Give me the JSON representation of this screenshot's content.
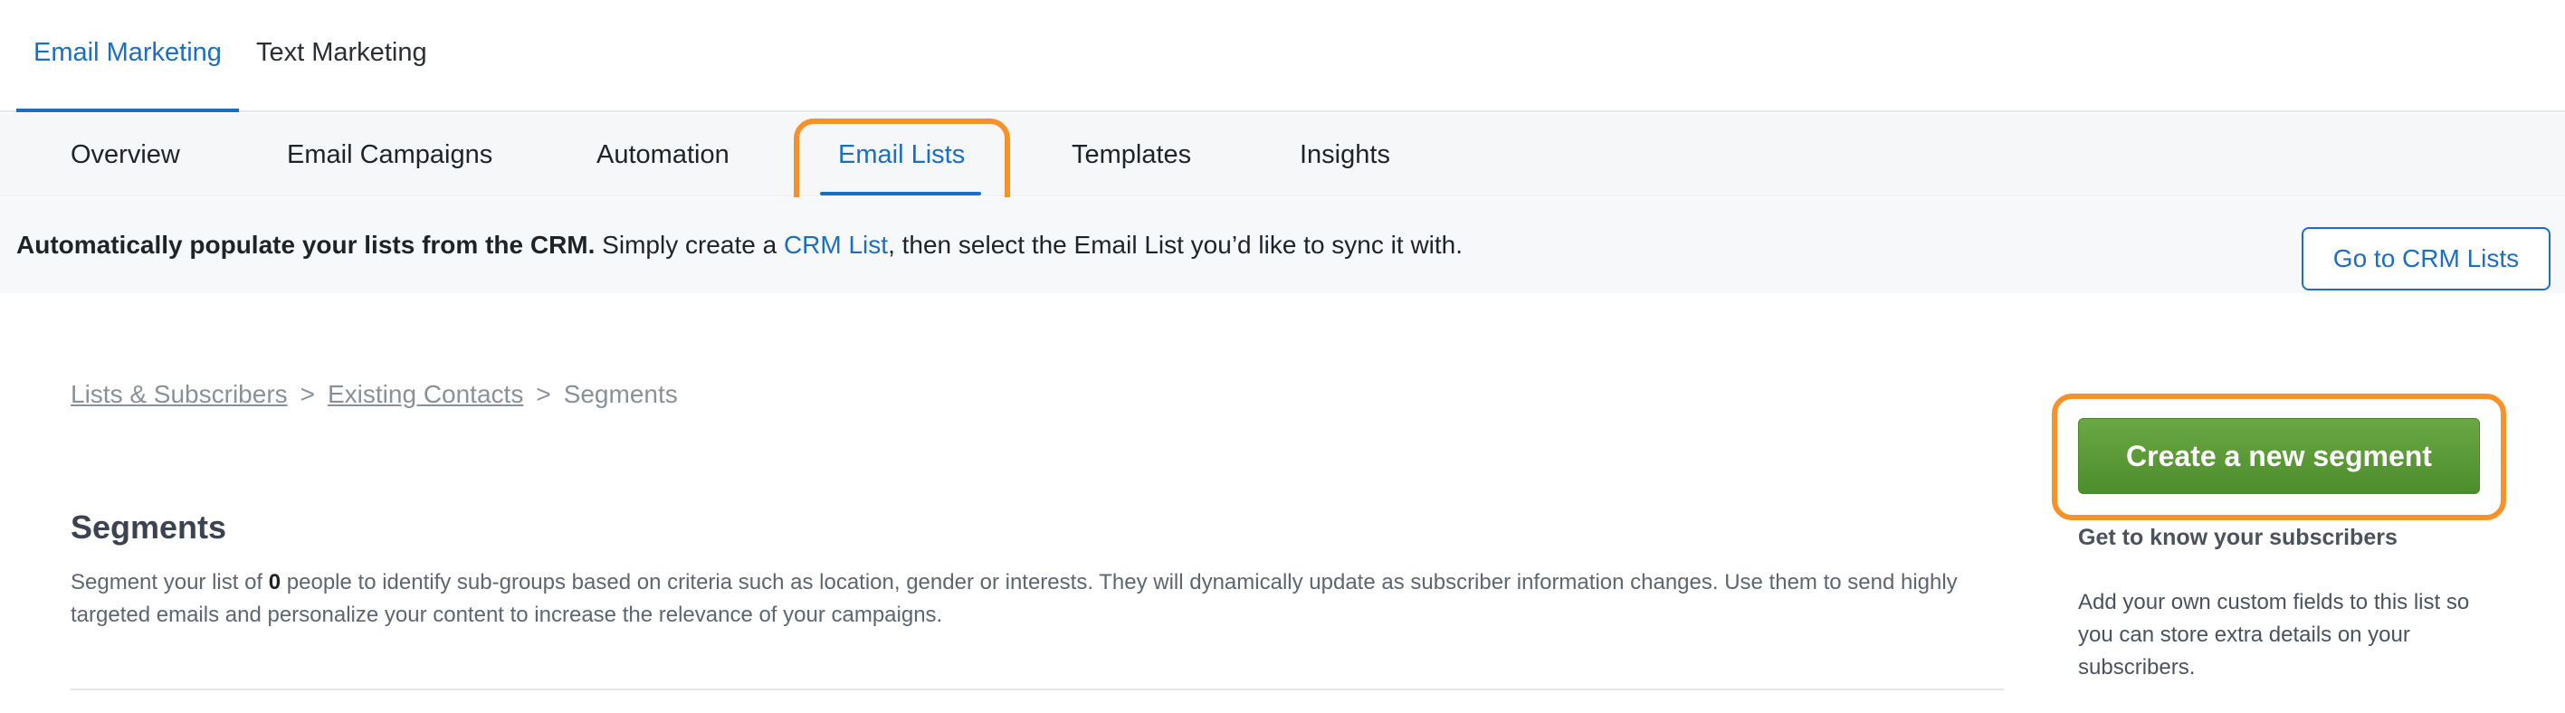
{
  "top_tabs": [
    {
      "label": "Email Marketing",
      "active": true
    },
    {
      "label": "Text Marketing",
      "active": false
    }
  ],
  "sub_nav": [
    {
      "label": "Overview"
    },
    {
      "label": "Email Campaigns"
    },
    {
      "label": "Automation"
    },
    {
      "label": "Email Lists",
      "active": true
    },
    {
      "label": "Templates"
    },
    {
      "label": "Insights"
    }
  ],
  "banner": {
    "bold": "Automatically populate your lists from the CRM.",
    "pre_link": " Simply create a ",
    "link": "CRM List",
    "post_link": ", then select the Email List you’d like to sync it with.",
    "button": "Go to CRM Lists"
  },
  "breadcrumb": {
    "items": [
      "Lists & Subscribers",
      "Existing Contacts",
      "Segments"
    ],
    "separator": ">"
  },
  "main": {
    "title": "Segments",
    "desc_pre": "Segment your list of ",
    "desc_count": "0",
    "desc_post": " people to identify sub-groups based on criteria such as location, gender or interests. They will dynamically update as subscriber information changes. Use them to send highly targeted emails and personalize your content to increase the relevance of your campaigns."
  },
  "sidebar": {
    "create_button": "Create a new segment",
    "heading": "Get to know your subscribers",
    "text": "Add your own custom fields to this list so you can store extra details on your subscribers."
  },
  "colors": {
    "accent": "#1b6ec2",
    "highlight": "#f7922a",
    "create_button": "#5c9b37"
  }
}
